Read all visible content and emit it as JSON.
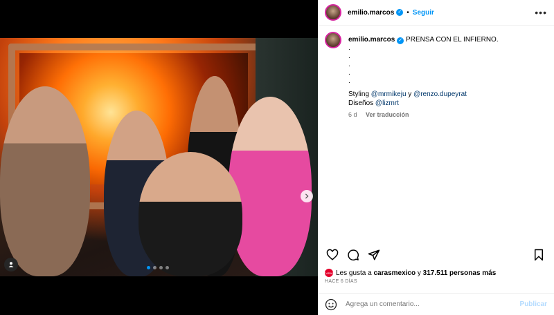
{
  "post": {
    "username": "emilio.marcos",
    "follow_label": "Seguir",
    "separator": "•",
    "more_label": "•••"
  },
  "caption": {
    "username": "emilio.marcos",
    "text": "PRENSA CON EL INFIERNO.",
    "dots": [
      ".",
      ".",
      ".",
      ".",
      "."
    ],
    "styling_prefix": "Styling",
    "styling_user1": "@mrmikeju",
    "styling_and": "y",
    "styling_user2": "@renzo.dupeyrat",
    "design_prefix": "Diseños",
    "design_user": "@lizmrt",
    "age": "6 d",
    "translate_label": "Ver traducción"
  },
  "likes": {
    "avatar_text": "CARAS",
    "prefix": "Les gusta a",
    "user": "carasmexico",
    "middle": "y",
    "count": "317.511 personas más"
  },
  "time_ago": "HACE 6 DÍAS",
  "comment": {
    "placeholder": "Agrega un comentario...",
    "publish_label": "Publicar"
  },
  "carousel": {
    "total": 4,
    "active_index": 0
  },
  "colors": {
    "accent": "#0095f6",
    "publish_disabled": "#b3dbff"
  }
}
